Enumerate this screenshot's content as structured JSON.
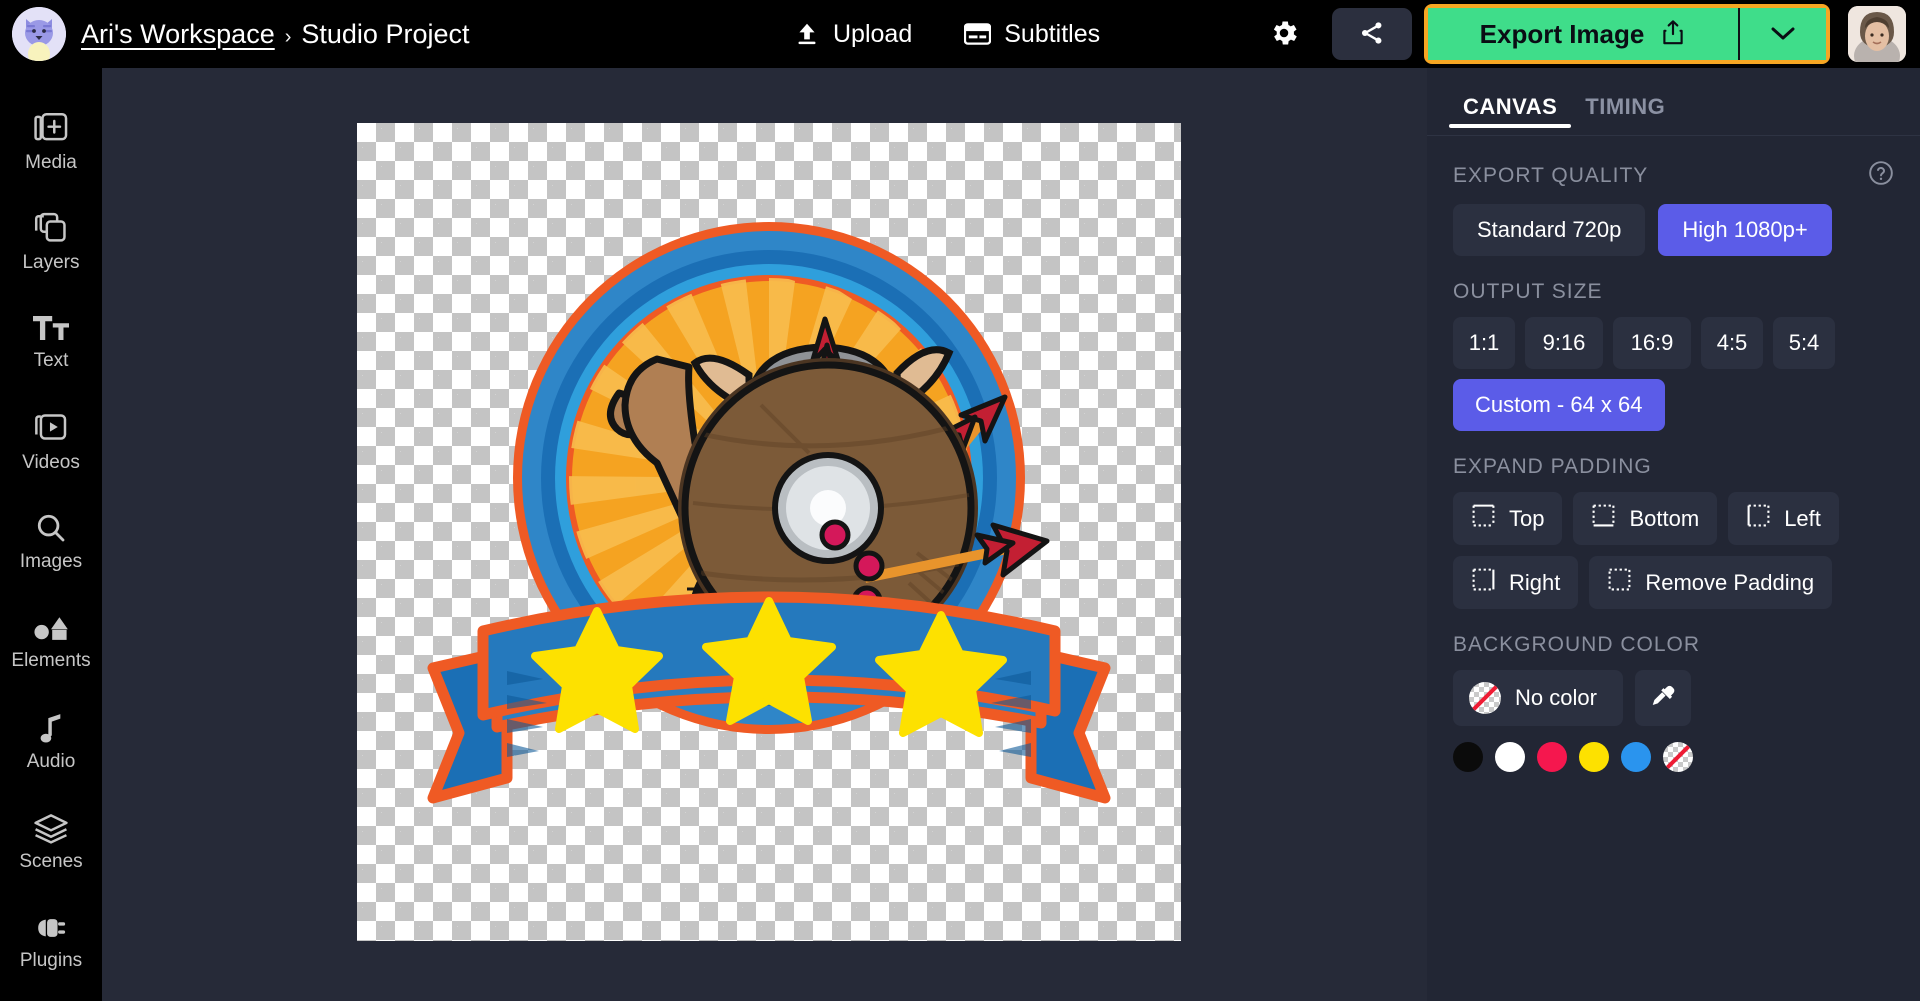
{
  "header": {
    "avatar_name": "cat-avatar",
    "workspace": "Ari's Workspace",
    "separator": "›",
    "project": "Studio Project",
    "upload_label": "Upload",
    "subtitles_label": "Subtitles",
    "settings_icon": "gear-icon",
    "share_icon": "share-icon",
    "export_label": "Export Image",
    "export_icon": "share-up-icon",
    "export_caret_icon": "chevron-down-icon",
    "user_avatar": "user-photo-avatar",
    "export_button_color": "#3fdd8a",
    "export_highlight_color": "#f6a623"
  },
  "sidebar": {
    "items": [
      {
        "label": "Media",
        "icon": "media-add-icon"
      },
      {
        "label": "Layers",
        "icon": "layers-copy-icon"
      },
      {
        "label": "Text",
        "icon": "text-tt-icon"
      },
      {
        "label": "Videos",
        "icon": "video-play-icon"
      },
      {
        "label": "Images",
        "icon": "search-icon"
      },
      {
        "label": "Elements",
        "icon": "shapes-icon"
      },
      {
        "label": "Audio",
        "icon": "music-note-icon"
      },
      {
        "label": "Scenes",
        "icon": "stack-icon"
      },
      {
        "label": "Plugins",
        "icon": "plug-icon"
      }
    ]
  },
  "canvas": {
    "background": "transparent-checkerboard",
    "artwork_name": "viking-warrior-badge-logo",
    "artwork_description": "Cartoon viking warrior holding a club behind a wooden shield struck by three arrows, on an orange sunburst disc with blue ring, above a blue ribbon banner with three yellow stars"
  },
  "panel": {
    "tabs": [
      {
        "label": "CANVAS",
        "active": true
      },
      {
        "label": "TIMING",
        "active": false
      }
    ],
    "export_quality": {
      "title": "EXPORT QUALITY",
      "help_icon": "question-circle-icon",
      "options": [
        {
          "label": "Standard 720p",
          "selected": false
        },
        {
          "label": "High 1080p+",
          "selected": true
        }
      ]
    },
    "output_size": {
      "title": "OUTPUT SIZE",
      "ratios": [
        {
          "label": "1:1",
          "selected": false
        },
        {
          "label": "9:16",
          "selected": false
        },
        {
          "label": "16:9",
          "selected": false
        },
        {
          "label": "4:5",
          "selected": false
        },
        {
          "label": "5:4",
          "selected": false
        }
      ],
      "custom": {
        "label": "Custom - 64 x 64",
        "selected": true
      }
    },
    "expand_padding": {
      "title": "EXPAND PADDING",
      "buttons": [
        {
          "label": "Top",
          "icon": "padding-top-icon"
        },
        {
          "label": "Bottom",
          "icon": "padding-bottom-icon"
        },
        {
          "label": "Left",
          "icon": "padding-left-icon"
        },
        {
          "label": "Right",
          "icon": "padding-right-icon"
        },
        {
          "label": "Remove Padding",
          "icon": "padding-remove-icon"
        }
      ]
    },
    "background_color": {
      "title": "BACKGROUND COLOR",
      "current_label": "No color",
      "eyedropper_icon": "eyedropper-icon",
      "swatches": [
        {
          "name": "black",
          "hex": "#0b0b0b"
        },
        {
          "name": "white",
          "hex": "#ffffff"
        },
        {
          "name": "red",
          "hex": "#f5174e"
        },
        {
          "name": "yellow",
          "hex": "#fde100"
        },
        {
          "name": "blue",
          "hex": "#2a94ee"
        },
        {
          "name": "transparent",
          "hex": "none"
        }
      ]
    },
    "accent_color": "#5b5ce8"
  }
}
